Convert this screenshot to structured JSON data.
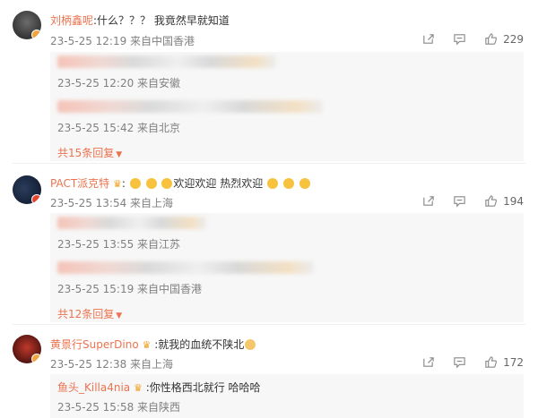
{
  "comments": [
    {
      "username": "刘柄鑫呢",
      "text": ":什么？？？    我竟然早就知道",
      "meta": "23-5-25 12:19 来自中国香港",
      "likes": "229",
      "replies": [
        {
          "meta": "23-5-25 12:20 来自安徽"
        },
        {
          "meta": "23-5-25 15:42 来自北京"
        }
      ],
      "more": "共15条回复"
    },
    {
      "username": "PACT派克特",
      "text_pre": ":",
      "text_mid": "欢迎欢迎 热烈欢迎",
      "meta": "23-5-25 13:54 来自上海",
      "likes": "194",
      "replies": [
        {
          "meta": "23-5-25 13:55 来自江苏"
        },
        {
          "meta": "23-5-25 15:19 来自中国香港"
        }
      ],
      "more": "共12条回复"
    },
    {
      "username": "黄景行SuperDino",
      "text": ":就我的血统不陕北",
      "meta": "23-5-25 12:38 来自上海",
      "likes": "172",
      "replies": [
        {
          "username": "鱼头_Killa4nia",
          "text": ":你性格西北就行 哈哈哈",
          "meta": "23-5-25 15:58 来自陕西"
        }
      ]
    }
  ],
  "icons": {
    "share": "share-icon",
    "comment": "comment-icon",
    "like": "thumbs-up-icon",
    "dropdown": "caret-down-icon",
    "crown": "crown-badge-icon",
    "emoji_clap": "clap-emoji-icon",
    "emoji_face": "cat-face-emoji-icon"
  },
  "colors": {
    "username": "#eb7350",
    "meta": "#808080",
    "reply_bg": "#f7f7f7"
  }
}
